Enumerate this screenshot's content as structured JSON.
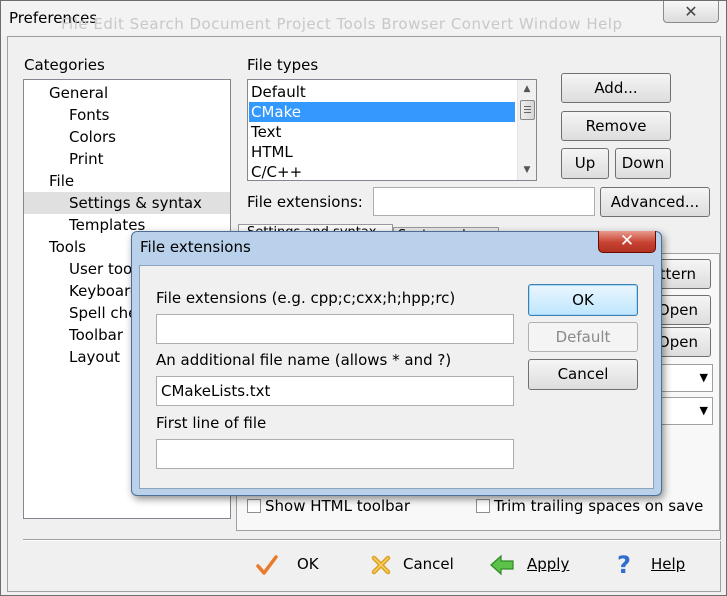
{
  "window": {
    "title": "Preferences",
    "ghost_menu": "File   Edit   Search   Document   Project   Tools   Browser   Convert   Window   Help",
    "close_glyph": "✕"
  },
  "categories": {
    "label": "Categories",
    "items": [
      {
        "label": "General"
      },
      {
        "label": "Fonts"
      },
      {
        "label": "Colors"
      },
      {
        "label": "Print"
      },
      {
        "label": "File"
      },
      {
        "label": "Settings & syntax"
      },
      {
        "label": "Templates"
      },
      {
        "label": "Tools"
      },
      {
        "label": "User tools"
      },
      {
        "label": "Keyboard"
      },
      {
        "label": "Spell check"
      },
      {
        "label": "Toolbar"
      },
      {
        "label": "Layout"
      }
    ]
  },
  "file_types": {
    "label": "File types",
    "items": [
      "Default",
      "CMake",
      "Text",
      "HTML",
      "C/C++"
    ],
    "selected": "CMake",
    "buttons": {
      "add": "Add...",
      "remove": "Remove",
      "up": "Up",
      "down": "Down"
    }
  },
  "file_extensions_row": {
    "label": "File extensions:",
    "value": "",
    "advanced": "Advanced..."
  },
  "tabs": {
    "settings": "Settings and syntax",
    "syntax_colors": "Syntax colors"
  },
  "right_partial": {
    "pattern": "Pattern",
    "open1": "Open",
    "open2": "Open"
  },
  "checkboxes": {
    "show_html_toolbar": "Show HTML toolbar",
    "trim_trailing": "Trim trailing spaces on save"
  },
  "footer": {
    "ok": "OK",
    "cancel": "Cancel",
    "apply": "Apply",
    "help": "Help"
  },
  "dialog": {
    "title": "File extensions",
    "close_glyph": "✕",
    "ext_label": "File extensions (e.g. cpp;c;cxx;h;hpp;rc)",
    "ext_value": "",
    "filename_label": "An additional file name (allows * and ?)",
    "filename_value": "CMakeLists.txt",
    "firstline_label": "First line of file",
    "firstline_value": "",
    "ok": "OK",
    "default": "Default",
    "cancel": "Cancel"
  }
}
